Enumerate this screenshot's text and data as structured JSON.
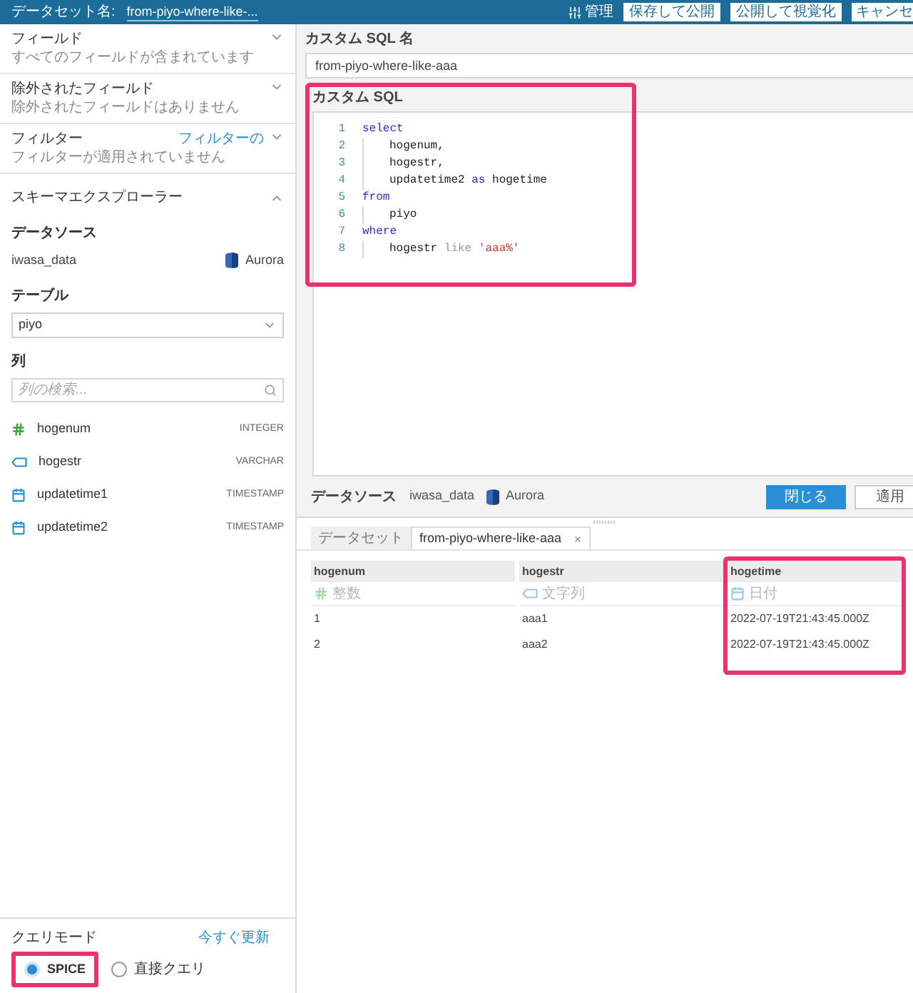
{
  "header": {
    "dataset_label": "データセット名:",
    "dataset_name": "from-piyo-where-like-...",
    "manage_label": "管理",
    "buttons": [
      "保存して公開",
      "公開して視覚化",
      "キャンセ"
    ]
  },
  "sections": [
    {
      "label": "フィールド",
      "hint": "すべてのフィールドが含まれています",
      "expanded": false
    },
    {
      "label": "除外されたフィールド",
      "hint": "除外されたフィールドはありません",
      "expanded": false
    },
    {
      "label": "フィルター",
      "hint": "フィルターが適用されていません",
      "link": "フィルターの",
      "expanded": false
    }
  ],
  "schema_explorer": {
    "title": "スキーマエクスプローラー",
    "expanded": true,
    "datasource_label": "データソース",
    "datasource": "iwasa_data",
    "engine": "Aurora",
    "table_label": "テーブル",
    "table": "piyo",
    "columns_label": "列",
    "column_search": {
      "placeholder": "列の検索..."
    },
    "columns": [
      {
        "name": "hogenum",
        "type": "INTEGER",
        "kind": "number"
      },
      {
        "name": "hogestr",
        "type": "VARCHAR",
        "kind": "string"
      },
      {
        "name": "updatetime1",
        "type": "TIMESTAMP",
        "kind": "date"
      },
      {
        "name": "updatetime2",
        "type": "TIMESTAMP",
        "kind": "date"
      }
    ]
  },
  "query_mode": {
    "label": "クエリモード",
    "refresh_link": "今すぐ更新",
    "options": [
      {
        "label": "SPICE",
        "selected": true
      },
      {
        "label": "直接クエリ",
        "selected": false
      }
    ]
  },
  "custom_sql": {
    "name_label": "カスタム SQL 名",
    "name_value": "from-piyo-where-like-aaa",
    "sql_label": "カスタム SQL",
    "lines": [
      {
        "number": "1",
        "indented": false,
        "tokens": [
          {
            "text": "select",
            "kind": "keyword"
          }
        ]
      },
      {
        "number": "2",
        "indented": true,
        "tokens": [
          {
            "text": "hogenum,",
            "kind": "plain"
          }
        ]
      },
      {
        "number": "3",
        "indented": true,
        "tokens": [
          {
            "text": "hogestr,",
            "kind": "plain"
          }
        ]
      },
      {
        "number": "4",
        "indented": true,
        "tokens": [
          {
            "text": "updatetime2 ",
            "kind": "plain"
          },
          {
            "text": "as",
            "kind": "keyword"
          },
          {
            "text": " hogetime",
            "kind": "plain"
          }
        ]
      },
      {
        "number": "5",
        "indented": false,
        "tokens": [
          {
            "text": "from",
            "kind": "keyword"
          }
        ]
      },
      {
        "number": "6",
        "indented": true,
        "tokens": [
          {
            "text": "piyo",
            "kind": "plain"
          }
        ]
      },
      {
        "number": "7",
        "indented": false,
        "tokens": [
          {
            "text": "where",
            "kind": "keyword"
          }
        ]
      },
      {
        "number": "8",
        "indented": true,
        "tokens": [
          {
            "text": "hogestr ",
            "kind": "plain"
          },
          {
            "text": "like",
            "kind": "operator"
          },
          {
            "text": " 'aaa%'",
            "kind": "string"
          }
        ]
      }
    ]
  },
  "datasource_bar": {
    "label": "データソース",
    "name": "iwasa_data",
    "engine": "Aurora",
    "buttons": [
      {
        "label": "閉じる",
        "primary": true
      },
      {
        "label": "適用",
        "primary": false
      }
    ]
  },
  "preview": {
    "tabs": [
      {
        "label": "データセット",
        "selected": false,
        "closable": false
      },
      {
        "label": "from-piyo-where-like-aaa",
        "selected": true,
        "closable": true
      }
    ],
    "columns": [
      {
        "name": "hogenum",
        "type": "整数",
        "kind": "number"
      },
      {
        "name": "hogestr",
        "type": "文字列",
        "kind": "string"
      },
      {
        "name": "hogetime",
        "type": "日付",
        "kind": "date"
      }
    ],
    "rows": [
      [
        "1",
        "aaa1",
        "2022-07-19T21:43:45.000Z"
      ],
      [
        "2",
        "aaa2",
        "2022-07-19T21:43:45.000Z"
      ]
    ]
  }
}
